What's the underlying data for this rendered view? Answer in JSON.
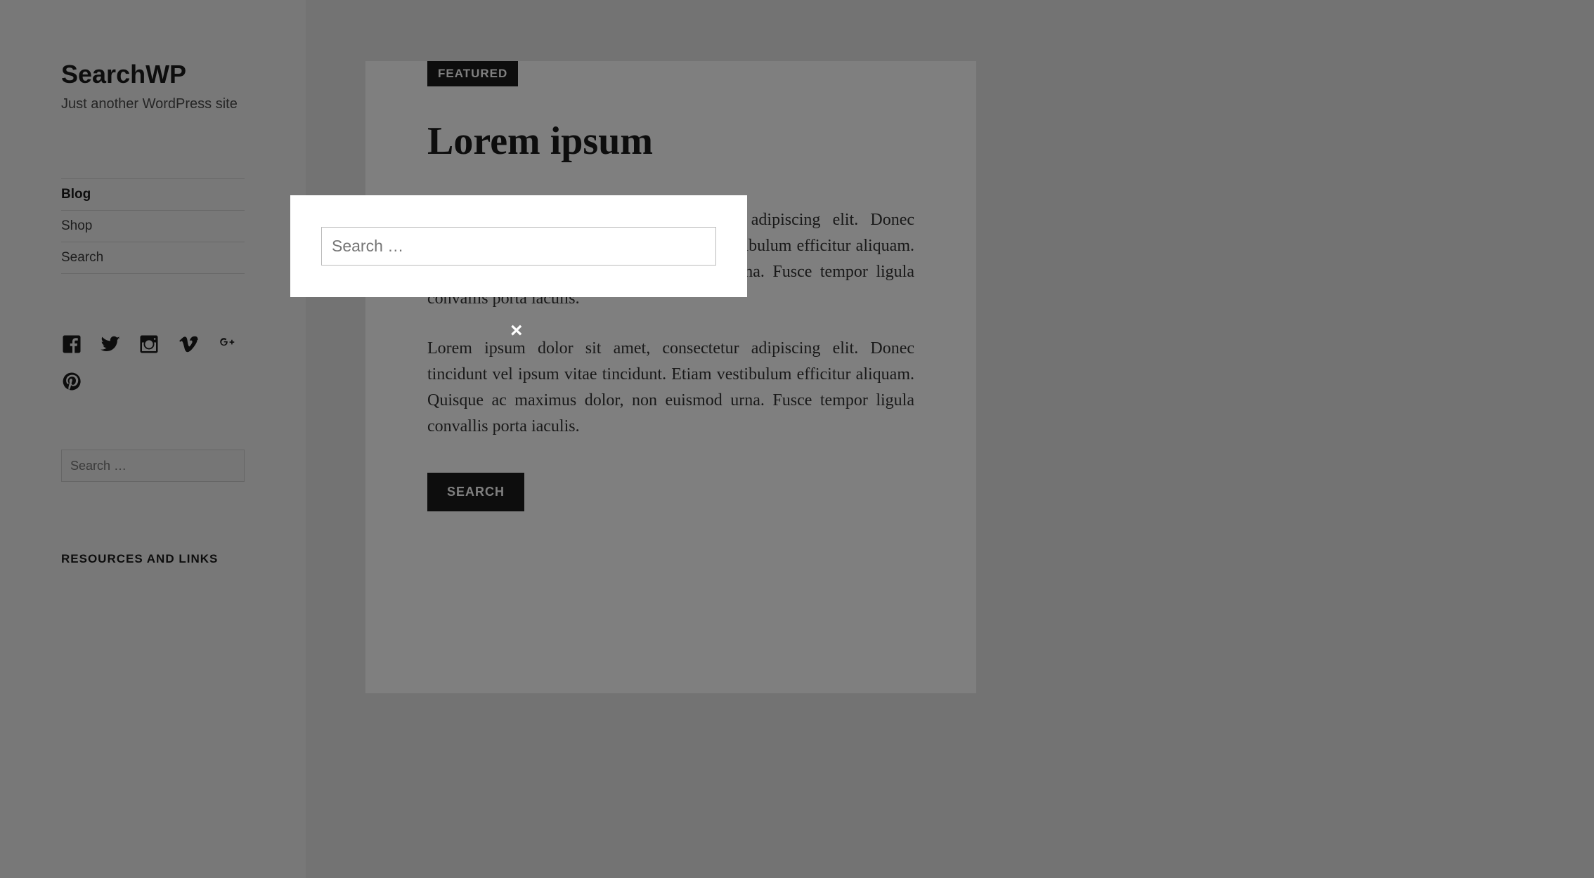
{
  "site": {
    "title": "SearchWP",
    "tagline": "Just another WordPress site"
  },
  "nav": {
    "items": [
      {
        "label": "Blog",
        "active": true
      },
      {
        "label": "Shop",
        "active": false
      },
      {
        "label": "Search",
        "active": false
      }
    ]
  },
  "social": {
    "icons": [
      "facebook-icon",
      "twitter-icon",
      "instagram-icon",
      "vimeo-icon",
      "googleplus-icon",
      "pinterest-icon"
    ]
  },
  "sidebar_search": {
    "placeholder": "Search …"
  },
  "widget": {
    "title": "RESOURCES AND LINKS"
  },
  "post": {
    "badge": "FEATURED",
    "title": "Lorem ipsum",
    "paragraphs": [
      "Lorem ipsum dolor sit amet, consectetur adipiscing elit. Donec tincidunt vel ipsum vitae tincidunt. Etiam vestibulum efficitur ali­quam. Quisque ac maximus dolor, non euismod urna. Fusce tem­por ligula convallis porta iaculis.",
      "Lorem ipsum dolor sit amet, consectetur adipiscing elit. Donec tincidunt vel ipsum vitae tincidunt. Etiam vestibulum efficitur ali­quam. Quisque ac maximus dolor, non euismod urna. Fusce tem­por ligula convallis porta iaculis."
    ],
    "button": "SEARCH"
  },
  "modal": {
    "placeholder": "Search …",
    "close": "×"
  }
}
